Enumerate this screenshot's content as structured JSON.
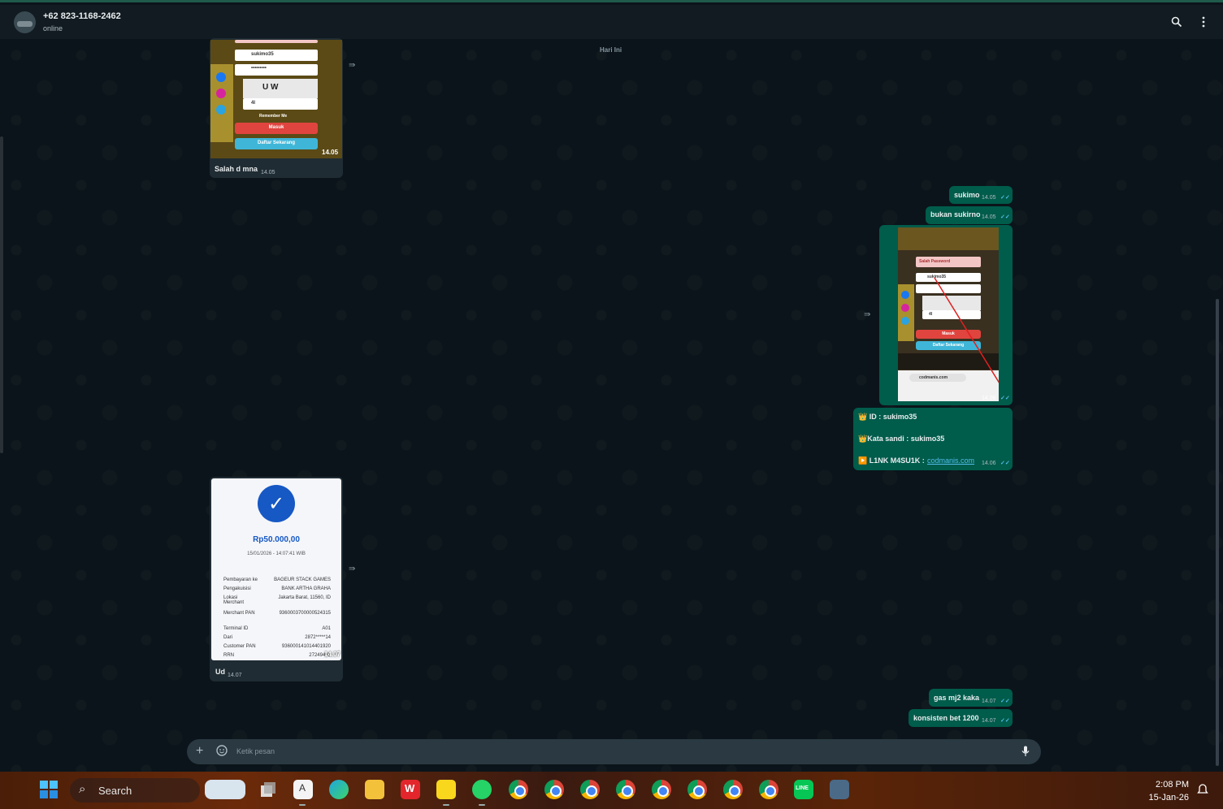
{
  "header": {
    "contact_name": "+62 823-1168-2462",
    "status": "online",
    "search_icon": "search-icon",
    "menu_icon": "kebab-menu-icon"
  },
  "chat": {
    "date_chip": "Hari Ini",
    "messages": [
      {
        "dir": "in",
        "type": "image",
        "caption": "Salah d mna",
        "time": "14.05",
        "image_time": "14.05",
        "image_text": {
          "username": "sukimo35",
          "password": "•••••••••",
          "captcha": "U  W",
          "code": "4l",
          "remember": "Remember Me",
          "login_btn": "Masuk",
          "register_btn": "Daftar Sekarang"
        }
      },
      {
        "dir": "out",
        "type": "text",
        "text": "sukimo",
        "time": "14.05"
      },
      {
        "dir": "out",
        "type": "text",
        "text": "bukan sukirno",
        "time": "14.05"
      },
      {
        "dir": "out",
        "type": "image",
        "time": "14.06",
        "image_text": {
          "error": "Salah Password",
          "username": "sukimo35",
          "code": "4l",
          "url": "codmanis.com",
          "login_btn": "Masuk",
          "register_btn": "Daftar Sekarang"
        }
      },
      {
        "dir": "out",
        "type": "multiline",
        "time": "14.06",
        "lines": [
          "👑 ID :  sukimo35",
          "👑Kata sandi : sukimo35",
          "▶️ L1NK M4SU1K : "
        ],
        "link": "codmanis.com"
      },
      {
        "dir": "in",
        "type": "receipt",
        "caption": "Ud",
        "time": "14.07",
        "image_time": "14.07",
        "receipt": {
          "amount": "Rp50.000,00",
          "datetime": "15/01/2026 - 14:07:41 WIB",
          "rows": [
            {
              "k": "Pembayaran ke",
              "v": "BAGEUR STACK GAMES"
            },
            {
              "k": "Pengakuisisi",
              "v": "BANK ARTHA GRAHA"
            },
            {
              "k": "Lokasi Merchant",
              "v": "Jakarta Barat, 11560, ID"
            },
            {
              "k": "Merchant PAN",
              "v": "9360003700000524315"
            },
            {
              "k": "Terminal ID",
              "v": "A01"
            },
            {
              "k": "Dari",
              "v": "2872*****14"
            },
            {
              "k": "Customer PAN",
              "v": "936000141014401920"
            },
            {
              "k": "RRN",
              "v": "27249415"
            }
          ]
        }
      },
      {
        "dir": "out",
        "type": "text",
        "text": "gas mj2 kaka",
        "time": "14.07"
      },
      {
        "dir": "out",
        "type": "text",
        "text": "konsisten bet 1200",
        "time": "14.07"
      }
    ]
  },
  "composer": {
    "placeholder": "Ketik pesan",
    "add_icon": "plus-icon",
    "emoji_icon": "sticker-icon",
    "mic_icon": "mic-icon"
  },
  "taskbar": {
    "search_label": "Search",
    "time": "2:08 PM",
    "date": "15-Jan-26",
    "apps": [
      "start",
      "widgets",
      "task-view",
      "notepad",
      "edge",
      "file-explorer",
      "wps",
      "sticky-notes",
      "whatsapp",
      "chrome",
      "chrome",
      "chrome",
      "chrome",
      "chrome",
      "chrome",
      "chrome",
      "chrome",
      "line",
      "app"
    ]
  },
  "colors": {
    "incoming_bubble": "#202c33",
    "outgoing_bubble": "#005c4b",
    "read_ticks": "#53bdeb",
    "link": "#53bdeb"
  }
}
